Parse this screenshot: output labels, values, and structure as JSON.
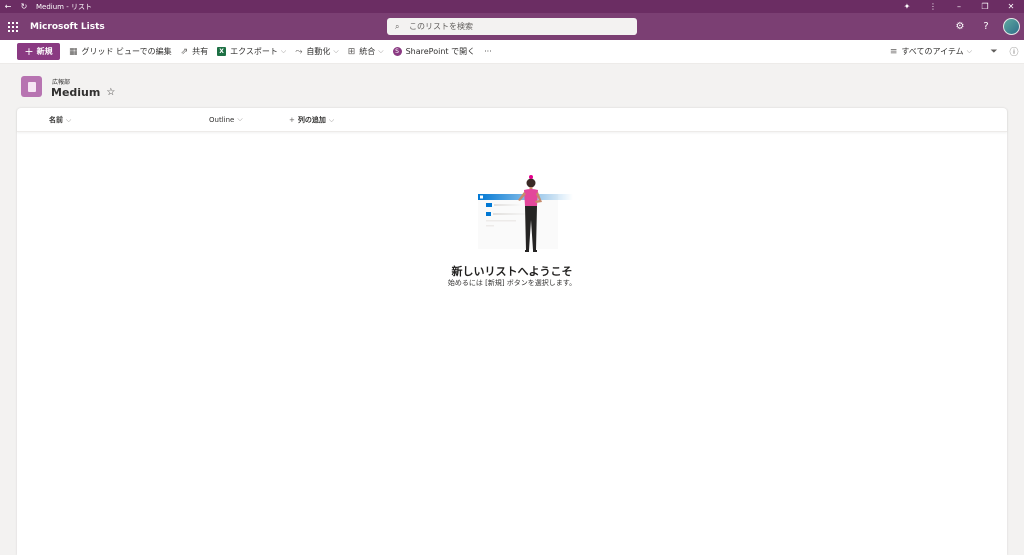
{
  "window": {
    "title": "Medium - リスト"
  },
  "suite": {
    "app_name": "Microsoft Lists",
    "search_placeholder": "このリストを検索"
  },
  "commands": {
    "new_label": "新規",
    "grid_edit": "グリッド ビューでの編集",
    "share": "共有",
    "export": "エクスポート",
    "automate": "自動化",
    "integrate": "統合",
    "open_sharepoint": "SharePoint で開く",
    "more": "···",
    "view_name": "すべてのアイテム"
  },
  "list": {
    "site": "広報部",
    "title": "Medium"
  },
  "columns": {
    "name": "名前",
    "outline": "Outline",
    "add_column": "列の追加"
  },
  "empty_state": {
    "title": "新しいリストへようこそ",
    "subtitle": "始めるには [新規] ボタンを選択します。"
  },
  "colors": {
    "titlebar": "#6b2d63",
    "suitebar": "#7b3f73",
    "accent": "#8a3a82",
    "list_icon": "#b774b1"
  }
}
